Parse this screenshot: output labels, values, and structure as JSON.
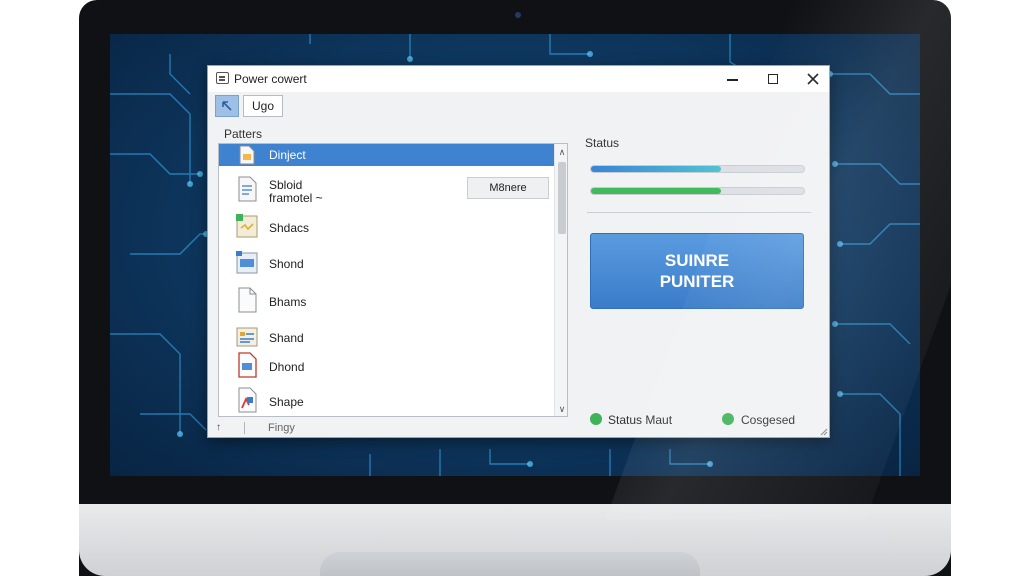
{
  "window": {
    "title": "Power cowert",
    "icon": "window-icon",
    "controls": [
      "minimize-icon",
      "maximize-icon",
      "close-icon"
    ]
  },
  "toolbar": {
    "active_tool_icon": "arrow-tool-icon",
    "button_label": "Ugo"
  },
  "left_panel": {
    "label": "Patters",
    "items": [
      {
        "label": "Dinject",
        "icon": "document-icon",
        "selected": true
      },
      {
        "label": "Sbloid\nframotel ~",
        "icon": "document-icon",
        "button_label": "M8nere"
      },
      {
        "label": "Shdacs",
        "icon": "folder-icon"
      },
      {
        "label": "Shond",
        "icon": "screen-document-icon"
      },
      {
        "label": "Bhams",
        "icon": "blank-document-icon"
      },
      {
        "label": "Shand",
        "icon": "list-document-icon"
      },
      {
        "label": "Dhond",
        "icon": "red-document-icon"
      },
      {
        "label": "Shape",
        "icon": "shape-document-icon"
      }
    ],
    "footer_text": "Fingy"
  },
  "right_panel": {
    "label": "Status",
    "progress": [
      {
        "value": 0.61,
        "color": "#4fc3d4",
        "track_color": "#3a84d6"
      },
      {
        "value": 0.61,
        "color": "#3fba5c",
        "track_color": "#3fba5c"
      }
    ],
    "action_button": {
      "line1": "SUINRE",
      "line2": "PUNITER"
    },
    "status_items": [
      {
        "text": "Status Maut",
        "color": "#3fb35a"
      },
      {
        "text": "Cosgesed",
        "color": "#3fb35a"
      }
    ]
  },
  "colors": {
    "accent": "#3f82cf",
    "status_green": "#3fb35a"
  }
}
